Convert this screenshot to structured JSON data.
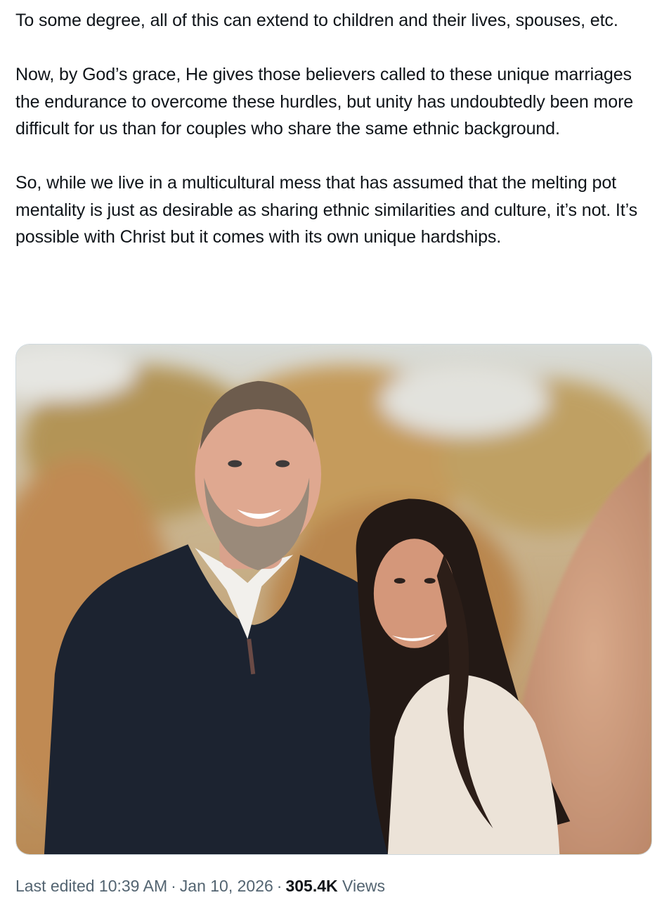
{
  "post": {
    "paragraphs": [
      "To some degree, all of this can extend to children and their lives, spouses, etc.",
      "Now, by God’s grace, He gives those believers called to these unique marriages the endurance to overcome these hurdles, but unity has undoubtedly been more difficult for us than for couples who share the same ethnic background.",
      "So, while we live in a multicultural mess that has assumed that the melting pot mentality is just as desirable as sharing ethnic similarities and culture, it’s not. It’s possible with Christ but it comes with its own unique hardships."
    ]
  },
  "meta": {
    "edited_label": "Last edited",
    "time": "10:39 AM",
    "separator": "·",
    "date": "Jan 10, 2026",
    "views_count": "305.4K",
    "views_label": "Views"
  },
  "colors": {
    "text_primary": "#0f1419",
    "text_secondary": "#536471",
    "border": "#cfd9de"
  }
}
